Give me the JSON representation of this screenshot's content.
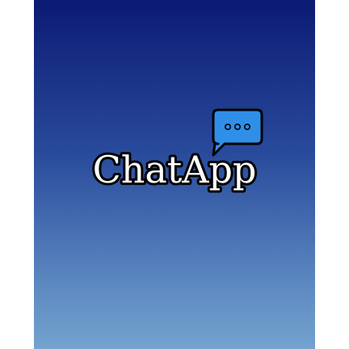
{
  "app": {
    "name": "ChatApp"
  },
  "colors": {
    "background_top": "#0b1a73",
    "background_bottom": "#73a3cf",
    "bubble_fill": "#2f8fe8",
    "logo_text_fill": "#ffffff",
    "logo_outline": "#000000"
  },
  "icons": {
    "logo_icon": "chat-bubble-icon"
  }
}
